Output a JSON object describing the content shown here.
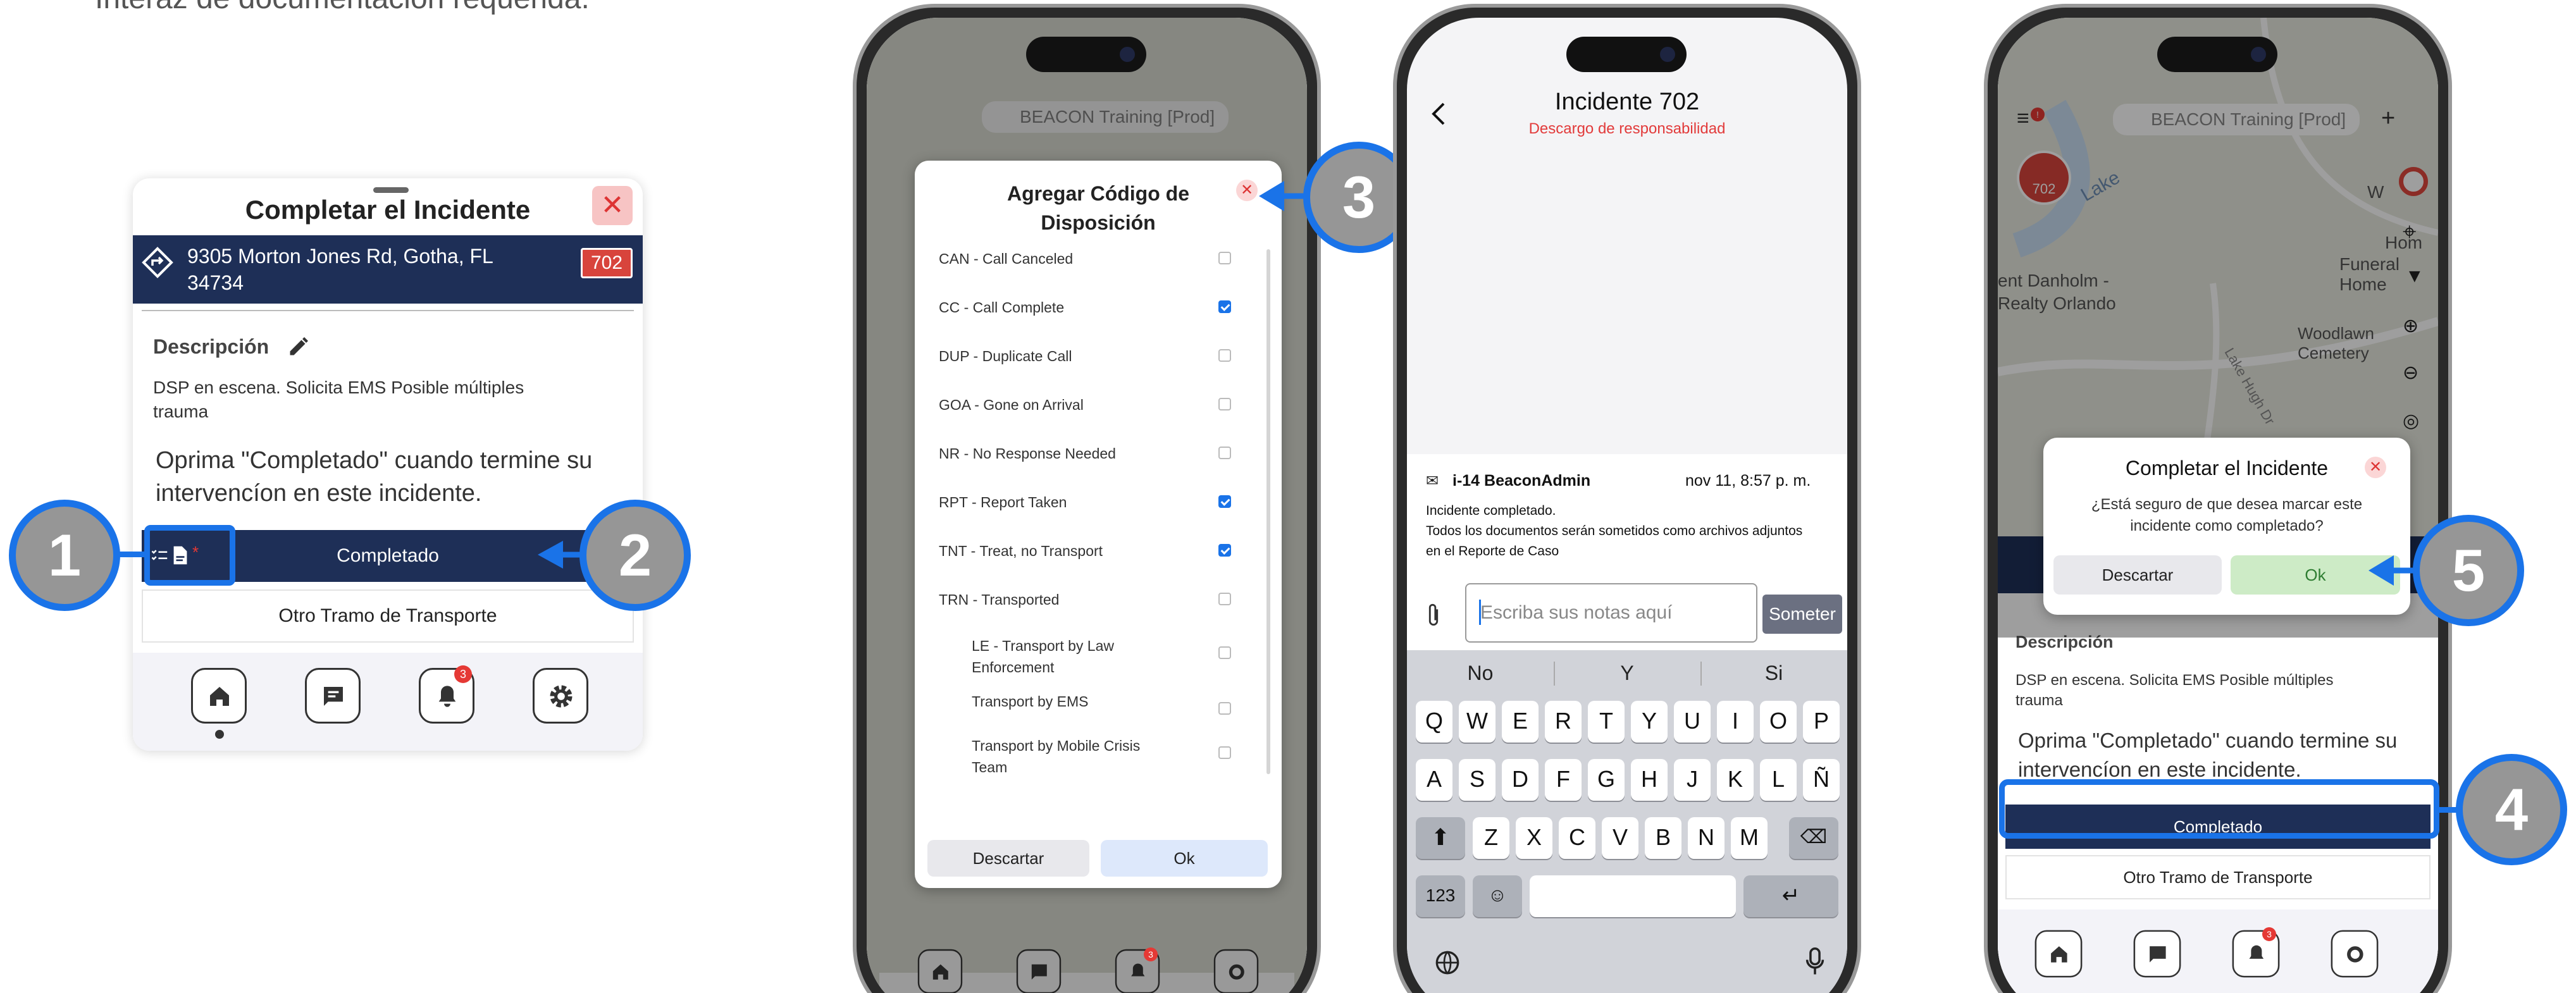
{
  "intro_text": "Interaz de documentación requerida.",
  "card": {
    "title": "Completar el Incidente",
    "close": "✕",
    "address_line1": "9305 Morton Jones Rd, Gotha, FL",
    "address_line2": "34734",
    "badge": "702",
    "description_label": "Descripción",
    "description_line1": "DSP en escena. Solicita EMS Posible múltiples",
    "description_line2": "trauma",
    "instruction_line1": "Oprima \"Completado\" cuando termine su",
    "instruction_line2": "intervencíon en este incidente.",
    "complete_button": "Completado",
    "other_button": "Otro Tramo de Transporte",
    "notif_count": "3"
  },
  "callouts": [
    "1",
    "2",
    "3",
    "4",
    "5"
  ],
  "phone1": {
    "search": "BEACON Training [Prod]",
    "modal_title_line1": "Agregar Código de",
    "modal_title_line2": "Disposición",
    "options": [
      {
        "label": "CAN - Call Canceled",
        "checked": false
      },
      {
        "label": "CC - Call Complete",
        "checked": true
      },
      {
        "label": "DUP - Duplicate Call",
        "checked": false
      },
      {
        "label": "GOA - Gone on Arrival",
        "checked": false
      },
      {
        "label": "NR - No Response Needed",
        "checked": false
      },
      {
        "label": "RPT - Report Taken",
        "checked": true
      },
      {
        "label": "TNT - Treat, no Transport",
        "checked": true
      },
      {
        "label": "TRN - Transported",
        "checked": false
      }
    ],
    "sub_options": [
      {
        "label1": "LE - Transport by Law",
        "label2": "Enforcement",
        "checked": false
      },
      {
        "label1": "Transport by EMS",
        "label2": "",
        "checked": false
      },
      {
        "label1": "Transport by Mobile Crisis",
        "label2": "Team",
        "checked": false
      }
    ],
    "discard": "Descartar",
    "ok": "Ok",
    "notif_count": "3"
  },
  "phone2": {
    "title": "Incidente 702",
    "subtitle": "Descargo de responsabilidad",
    "author": "i-14 BeaconAdmin",
    "timestamp": "nov 11, 8:57 p. m.",
    "msg_line1": "Incidente completado.",
    "msg_line2": "Todos los documentos serán sometidos como archivos adjuntos",
    "msg_line3": "en el Reporte de Caso",
    "notes_placeholder": "Escriba sus notas aquí",
    "submit": "Someter",
    "suggestions": [
      "No",
      "Y",
      "Si"
    ],
    "row1": [
      "Q",
      "W",
      "E",
      "R",
      "T",
      "Y",
      "U",
      "I",
      "O",
      "P"
    ],
    "row2": [
      "A",
      "S",
      "D",
      "F",
      "G",
      "H",
      "J",
      "K",
      "L",
      "Ñ"
    ],
    "row3": [
      "Z",
      "X",
      "C",
      "V",
      "B",
      "N",
      "M"
    ],
    "numkey": "123"
  },
  "phone3": {
    "search": "BEACON Training [Prod]",
    "map_labels": {
      "lake": "Lake",
      "w": "W",
      "hom": "Hom",
      "funeral": "Funeral Home",
      "realty1": "ent Danholm -",
      "realty2": "Realty Orlando",
      "cemetery": "Woodlawn Cemetery",
      "road": "Lake Hugh Dr"
    },
    "dialog_title": "Completar el Incidente",
    "dialog_line1": "¿Está seguro de que desea marcar este",
    "dialog_line2": "incidente como completado?",
    "discard": "Descartar",
    "ok": "Ok",
    "description_label": "Descripción",
    "description_line1": "DSP en escena. Solicita EMS Posible múltiples",
    "description_line2": "trauma",
    "instruction_line1": "Oprima \"Completado\" cuando termine su",
    "instruction_line2": "intervencíon en este incidente.",
    "complete_button": "Completado",
    "other_button": "Otro Tramo de Transporte",
    "notif_count": "3",
    "badge": "702"
  }
}
